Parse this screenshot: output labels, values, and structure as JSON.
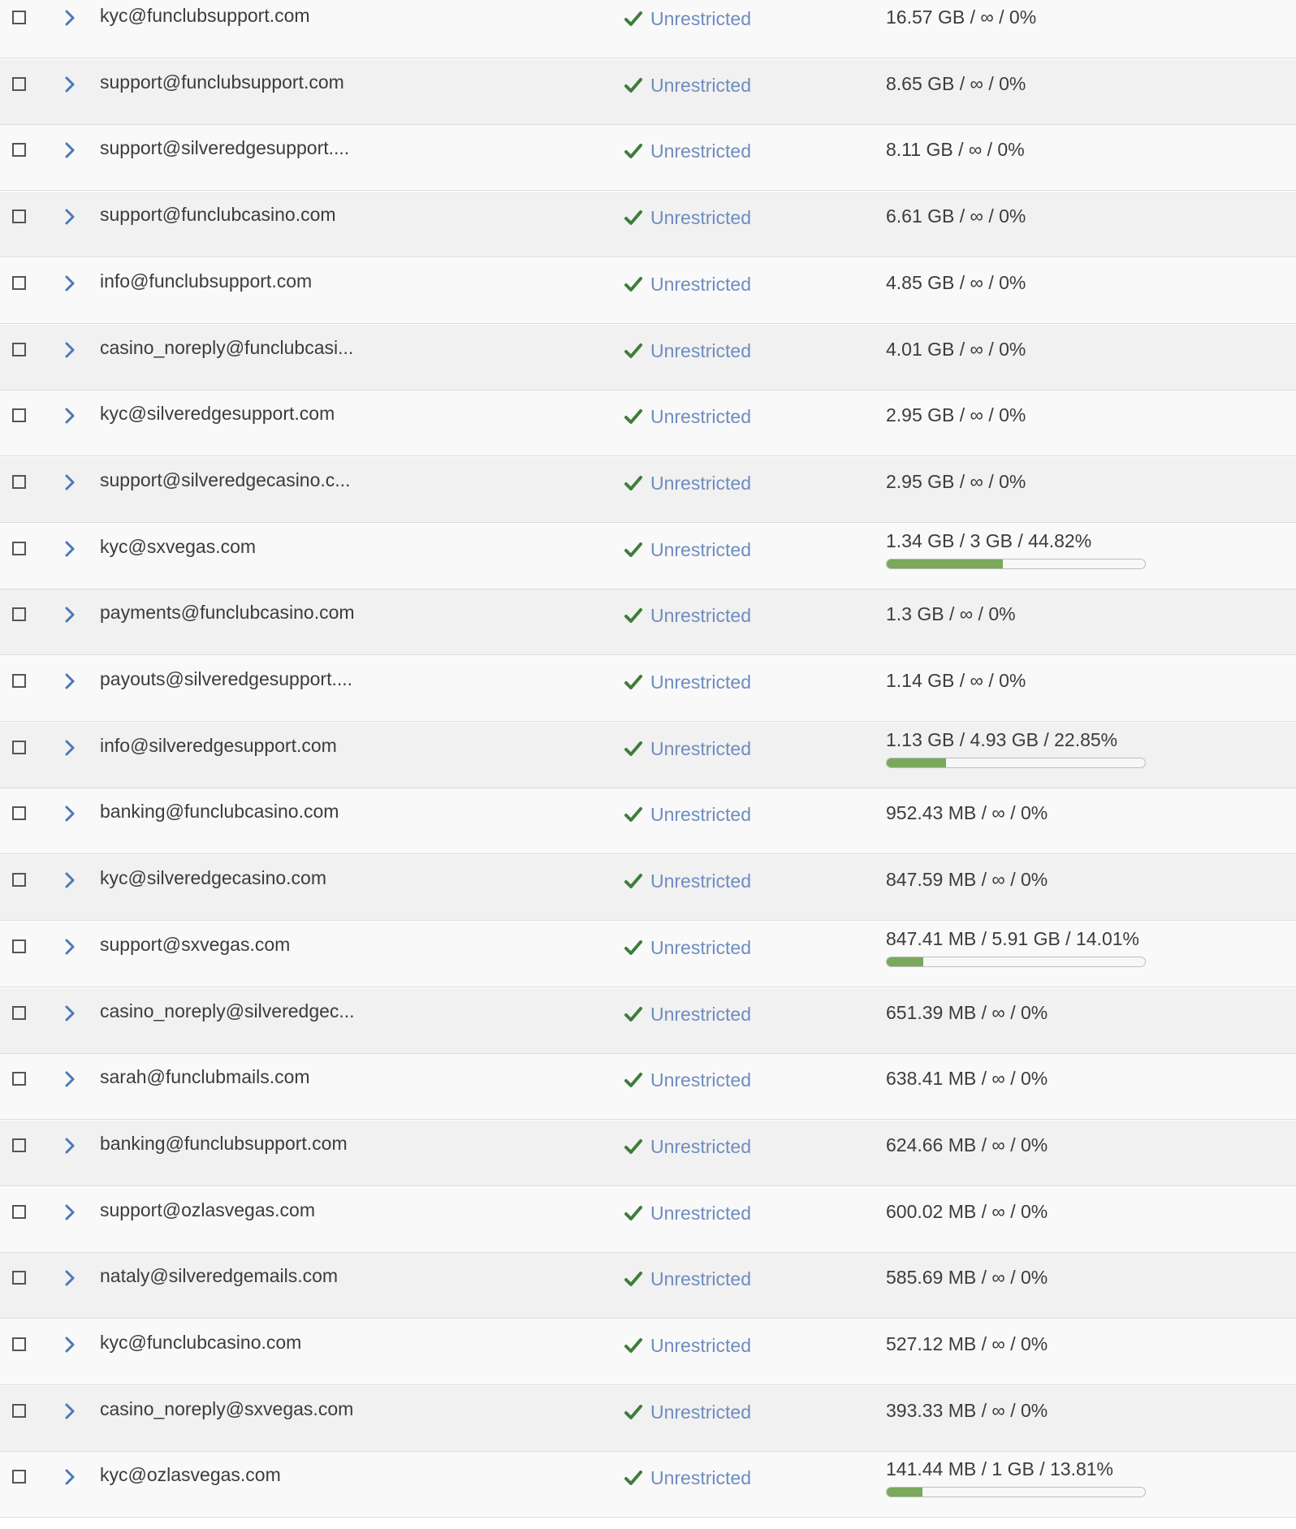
{
  "colors": {
    "status": "#6e8cc0",
    "check": "#3f7d3a",
    "chevron": "#4b78b8",
    "bar_fill": "#7aa85c"
  },
  "icons": {
    "checkbox": "checkbox-icon",
    "expand": "chevron-right-icon",
    "status": "checkmark-icon"
  },
  "mailboxes": [
    {
      "email": "kyc@funclubsupport.com",
      "status": "Unrestricted",
      "usage": "16.57 GB / ∞ / 0%",
      "quota_percent": null
    },
    {
      "email": "support@funclubsupport.com",
      "status": "Unrestricted",
      "usage": "8.65 GB / ∞ / 0%",
      "quota_percent": null
    },
    {
      "email": "support@silveredgesupport....",
      "status": "Unrestricted",
      "usage": "8.11 GB / ∞ / 0%",
      "quota_percent": null
    },
    {
      "email": "support@funclubcasino.com",
      "status": "Unrestricted",
      "usage": "6.61 GB / ∞ / 0%",
      "quota_percent": null
    },
    {
      "email": "info@funclubsupport.com",
      "status": "Unrestricted",
      "usage": "4.85 GB / ∞ / 0%",
      "quota_percent": null
    },
    {
      "email": "casino_noreply@funclubcasi...",
      "status": "Unrestricted",
      "usage": "4.01 GB / ∞ / 0%",
      "quota_percent": null
    },
    {
      "email": "kyc@silveredgesupport.com",
      "status": "Unrestricted",
      "usage": "2.95 GB / ∞ / 0%",
      "quota_percent": null
    },
    {
      "email": "support@silveredgecasino.c...",
      "status": "Unrestricted",
      "usage": "2.95 GB / ∞ / 0%",
      "quota_percent": null
    },
    {
      "email": "kyc@sxvegas.com",
      "status": "Unrestricted",
      "usage": "1.34 GB / 3 GB / 44.82%",
      "quota_percent": 44.82
    },
    {
      "email": "payments@funclubcasino.com",
      "status": "Unrestricted",
      "usage": "1.3 GB / ∞ / 0%",
      "quota_percent": null
    },
    {
      "email": "payouts@silveredgesupport....",
      "status": "Unrestricted",
      "usage": "1.14 GB / ∞ / 0%",
      "quota_percent": null
    },
    {
      "email": "info@silveredgesupport.com",
      "status": "Unrestricted",
      "usage": "1.13 GB / 4.93 GB / 22.85%",
      "quota_percent": 22.85
    },
    {
      "email": "banking@funclubcasino.com",
      "status": "Unrestricted",
      "usage": "952.43 MB / ∞ / 0%",
      "quota_percent": null
    },
    {
      "email": "kyc@silveredgecasino.com",
      "status": "Unrestricted",
      "usage": "847.59 MB / ∞ / 0%",
      "quota_percent": null
    },
    {
      "email": "support@sxvegas.com",
      "status": "Unrestricted",
      "usage": "847.41 MB / 5.91 GB / 14.01%",
      "quota_percent": 14.01
    },
    {
      "email": "casino_noreply@silveredgec...",
      "status": "Unrestricted",
      "usage": "651.39 MB / ∞ / 0%",
      "quota_percent": null
    },
    {
      "email": "sarah@funclubmails.com",
      "status": "Unrestricted",
      "usage": "638.41 MB / ∞ / 0%",
      "quota_percent": null
    },
    {
      "email": "banking@funclubsupport.com",
      "status": "Unrestricted",
      "usage": "624.66 MB / ∞ / 0%",
      "quota_percent": null
    },
    {
      "email": "support@ozlasvegas.com",
      "status": "Unrestricted",
      "usage": "600.02 MB / ∞ / 0%",
      "quota_percent": null
    },
    {
      "email": "nataly@silveredgemails.com",
      "status": "Unrestricted",
      "usage": "585.69 MB / ∞ / 0%",
      "quota_percent": null
    },
    {
      "email": "kyc@funclubcasino.com",
      "status": "Unrestricted",
      "usage": "527.12 MB / ∞ / 0%",
      "quota_percent": null
    },
    {
      "email": "casino_noreply@sxvegas.com",
      "status": "Unrestricted",
      "usage": "393.33 MB / ∞ / 0%",
      "quota_percent": null
    },
    {
      "email": "kyc@ozlasvegas.com",
      "status": "Unrestricted",
      "usage": "141.44 MB / 1 GB / 13.81%",
      "quota_percent": 13.81
    }
  ]
}
